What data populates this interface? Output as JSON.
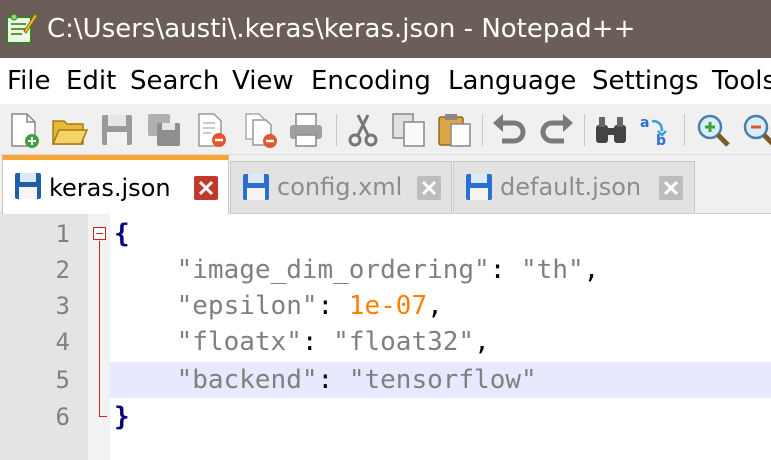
{
  "window": {
    "title": "C:\\Users\\austi\\.keras\\keras.json - Notepad++"
  },
  "menu": [
    "File",
    "Edit",
    "Search",
    "View",
    "Encoding",
    "Language",
    "Settings",
    "Tools"
  ],
  "toolbar": {
    "icons": [
      "new-file-icon",
      "open-file-icon",
      "save-icon",
      "save-all-icon",
      "close-icon",
      "close-all-icon",
      "print-icon",
      "cut-icon",
      "copy-icon",
      "paste-icon",
      "undo-icon",
      "redo-icon",
      "find-icon",
      "replace-icon",
      "zoom-in-icon",
      "zoom-out-icon"
    ]
  },
  "tabs": [
    {
      "label": "keras.json",
      "active": true
    },
    {
      "label": "config.xml",
      "active": false
    },
    {
      "label": "default.json",
      "active": false
    }
  ],
  "editor": {
    "current_line": 5,
    "lines": [
      {
        "num": "1",
        "brace": "{"
      },
      {
        "num": "2",
        "indent": "    ",
        "key": "\"image_dim_ordering\"",
        "sep": ": ",
        "value": "\"th\"",
        "end": ","
      },
      {
        "num": "3",
        "indent": "    ",
        "key": "\"epsilon\"",
        "sep": ": ",
        "value": "1e-07",
        "end": ","
      },
      {
        "num": "4",
        "indent": "    ",
        "key": "\"floatx\"",
        "sep": ": ",
        "value": "\"float32\"",
        "end": ","
      },
      {
        "num": "5",
        "indent": "    ",
        "key": "\"backend\"",
        "sep": ": ",
        "value": "\"tensorflow\"",
        "end": ""
      },
      {
        "num": "6",
        "brace": "}"
      }
    ]
  },
  "colors": {
    "titlebar": "#6b5e58",
    "active_tab_accent": "#f7a731",
    "current_line": "#e8e8ff",
    "string": "#808080",
    "number": "#ff8000",
    "brace": "#000080",
    "fold_marker": "#cc2222"
  }
}
